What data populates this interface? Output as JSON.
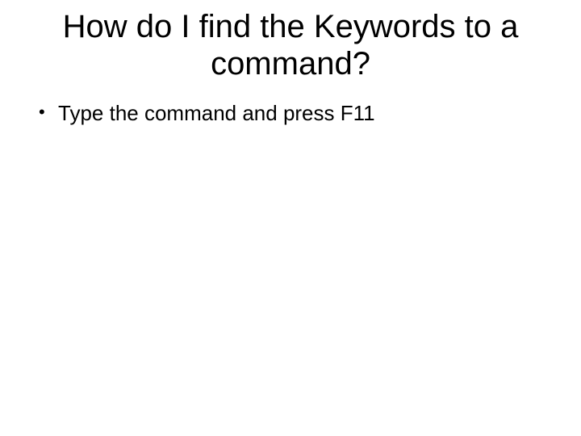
{
  "slide": {
    "title": "How do I find the Keywords to a command?",
    "bullets": [
      "Type the command and press F11"
    ]
  }
}
